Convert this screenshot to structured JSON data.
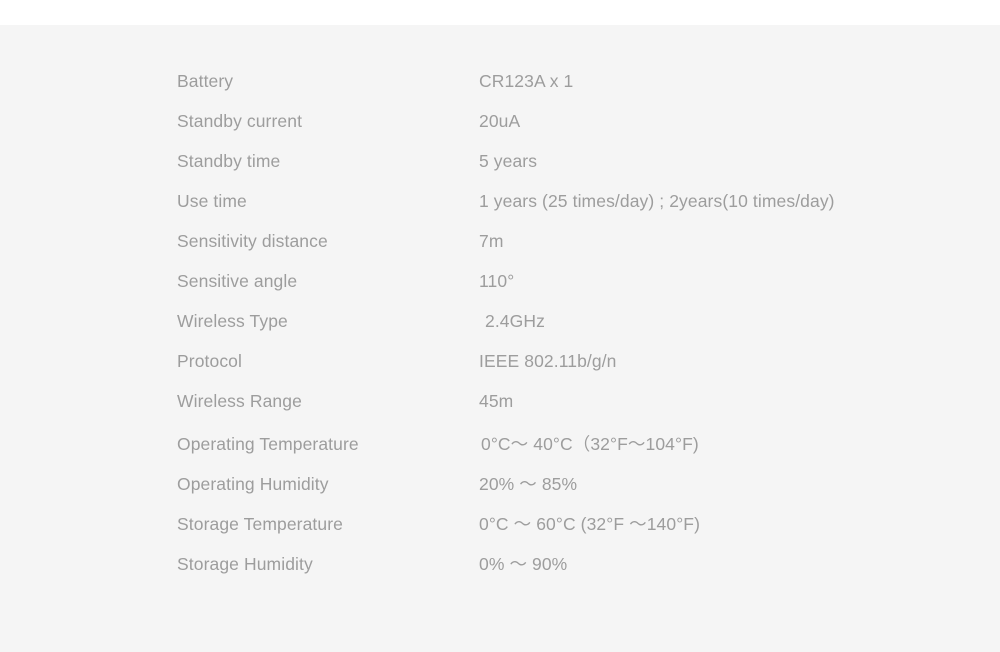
{
  "page": {
    "title": "Product Specification Table",
    "background_color": "#f5f5f5",
    "text_color": "#9d9d9d",
    "top_band_color": "#ffffff"
  },
  "spec_table": {
    "rows": [
      {
        "label": "Battery",
        "value": "CR123A x 1"
      },
      {
        "label": "Standby current",
        "value": "20uA"
      },
      {
        "label": "Standby time",
        "value": "5 years"
      },
      {
        "label": "Use time",
        "value": "1 years (25 times/day) ; 2years(10 times/day)"
      },
      {
        "label": "Sensitivity distance",
        "value": "7m"
      },
      {
        "label": "Sensitive angle",
        "value": "110°"
      },
      {
        "label": "Wireless Type",
        "value": "2.4GHz"
      },
      {
        "label": "Protocol",
        "value": "IEEE 802.11b/g/n"
      },
      {
        "label": "Wireless Range",
        "value": "45m"
      },
      {
        "label": "Operating Temperature",
        "value": "0°C～ 40°C（32°F～104°F)"
      },
      {
        "label": "Operating Humidity",
        "value": "20% ～ 85%"
      },
      {
        "label": "Storage Temperature",
        "value": "0°C ～ 60°C (32°F ～140°F)"
      },
      {
        "label": "Storage Humidity",
        "value": "0% ～ 90%"
      }
    ]
  }
}
